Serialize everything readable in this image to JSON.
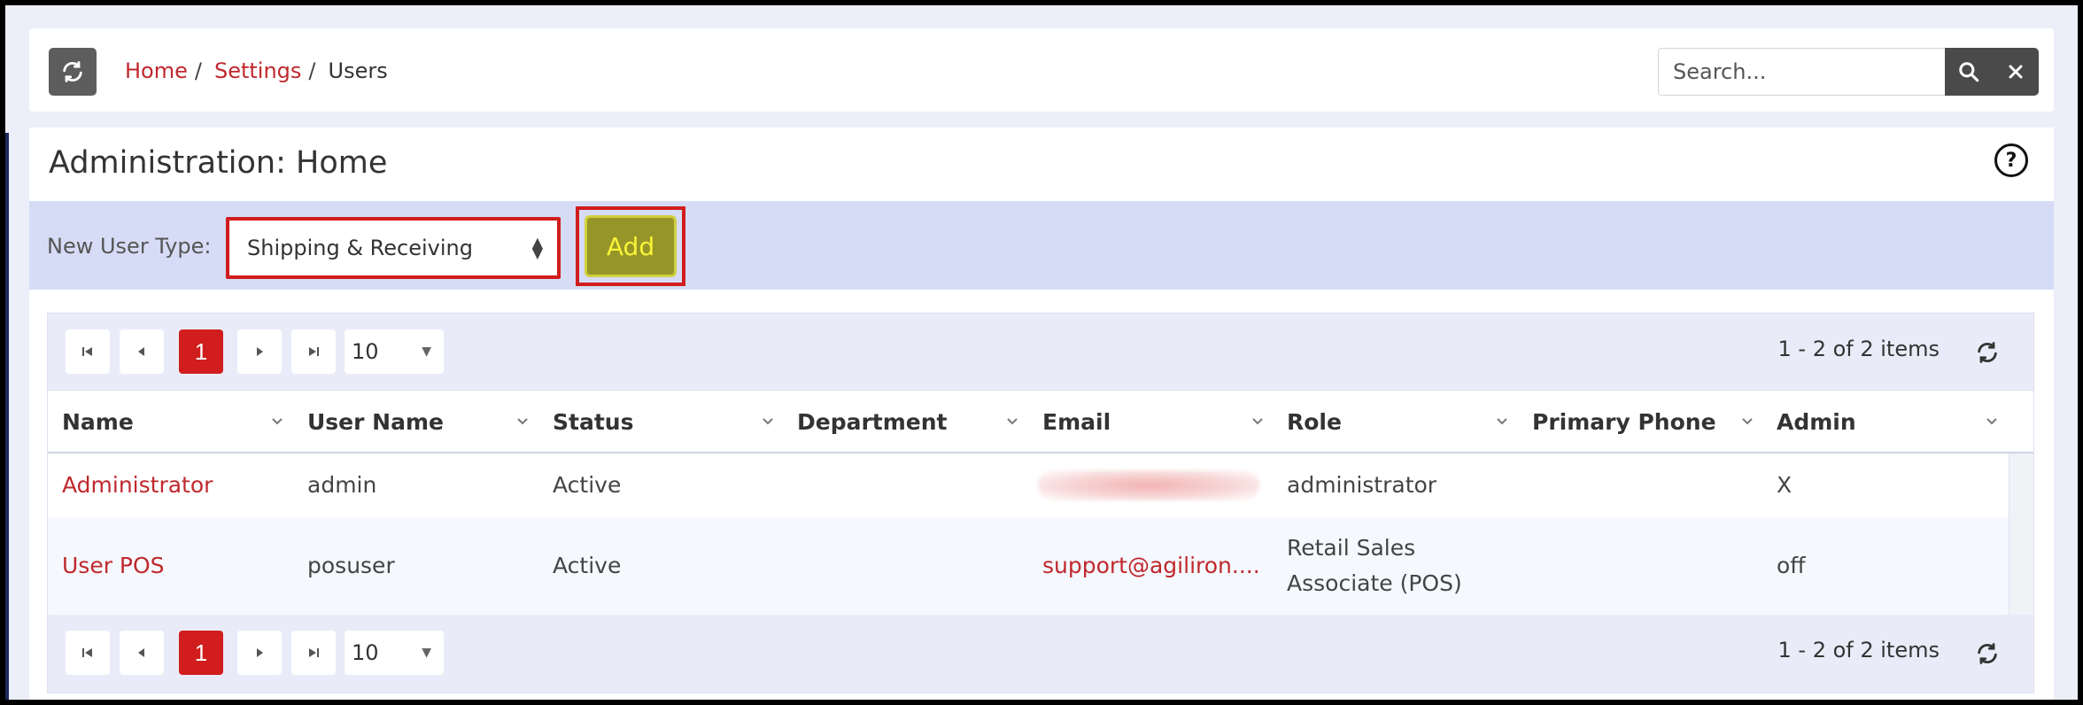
{
  "breadcrumb": {
    "items": [
      {
        "label": "Home"
      },
      {
        "label": "Settings"
      },
      {
        "label": "Users"
      }
    ],
    "separator": "/"
  },
  "search": {
    "placeholder": "Search...",
    "value": ""
  },
  "page": {
    "title": "Administration: Home",
    "help_icon": "?"
  },
  "new_user": {
    "label": "New User Type:",
    "selected_type": "Shipping & Receiving",
    "add_label": "Add"
  },
  "pager": {
    "current_page": "1",
    "page_size": "10",
    "info": "1 - 2 of 2 items"
  },
  "table": {
    "columns": [
      "Name",
      "User Name",
      "Status",
      "Department",
      "Email",
      "Role",
      "Primary Phone",
      "Admin"
    ],
    "rows": [
      {
        "name": "Administrator",
        "username": "admin",
        "status": "Active",
        "department": "",
        "email": "",
        "role": "administrator",
        "phone": "",
        "admin": "X"
      },
      {
        "name": "User POS",
        "username": "posuser",
        "status": "Active",
        "department": "",
        "email": "support@agiliron....",
        "role_line1": "Retail Sales",
        "role_line2": "Associate (POS)",
        "phone": "",
        "admin": "off"
      }
    ]
  },
  "colors": {
    "accent_red": "#c0282d",
    "add_button": "#969628",
    "toolbar_bg": "#d6dcf6"
  }
}
